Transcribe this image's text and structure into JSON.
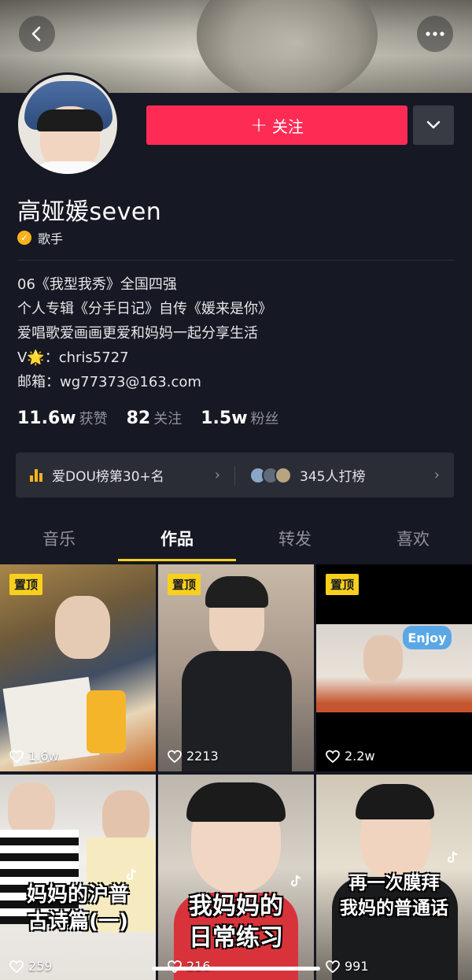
{
  "profile": {
    "name": "高娅媛seven",
    "verify_label": "歌手",
    "follow_label": "关注",
    "bio": [
      "06《我型我秀》全国四强",
      "个人专辑《分手日记》自传《媛来是你》",
      "爱唱歌爱画画更爱和妈妈一起分享生活",
      "V🌟：chris5727",
      "邮箱：wg77373@163.com"
    ],
    "stats": [
      {
        "num": "11.6w",
        "label": "获赞"
      },
      {
        "num": "82",
        "label": "关注"
      },
      {
        "num": "1.5w",
        "label": "粉丝"
      }
    ],
    "rank_text": "爱DOU榜第30+名",
    "supporters_text": "345人打榜"
  },
  "tabs": [
    "音乐",
    "作品",
    "转发",
    "喜欢"
  ],
  "active_tab": "作品",
  "pin_label": "置顶",
  "videos": [
    {
      "likes": "1.6w",
      "pinned": true,
      "caption": ""
    },
    {
      "likes": "2213",
      "pinned": true,
      "caption": ""
    },
    {
      "likes": "2.2w",
      "pinned": true,
      "caption": "",
      "sticker": "Enjoy"
    },
    {
      "likes": "259",
      "pinned": false,
      "caption": "妈妈的沪普\n古诗篇(一)"
    },
    {
      "likes": "216",
      "pinned": false,
      "caption": "我妈妈的\n日常练习"
    },
    {
      "likes": "991",
      "pinned": false,
      "caption": "再一次膜拜\n我妈的普通话"
    }
  ],
  "colors": {
    "accent": "#fe2c55",
    "background": "#161823",
    "highlight": "#f8d01c",
    "verify": "#f8b21c"
  }
}
